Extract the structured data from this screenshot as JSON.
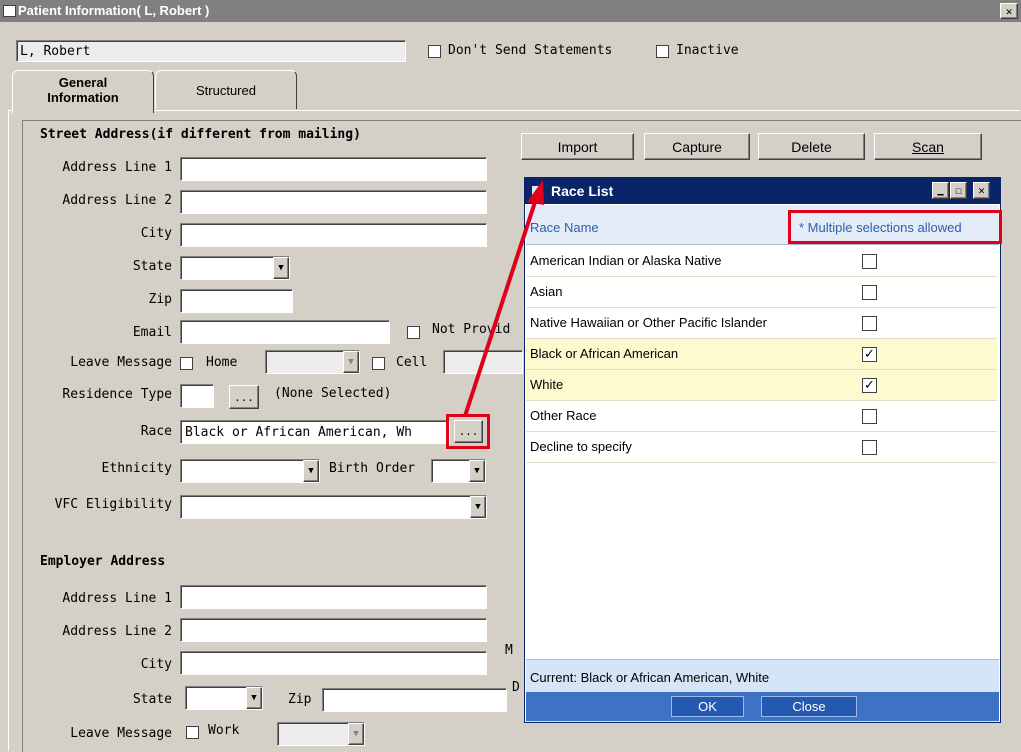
{
  "window": {
    "title": "Patient Information( L, Robert )",
    "close_glyph": "✕"
  },
  "patient": {
    "name": "L, Robert",
    "dont_send_label": "Don't Send Statements",
    "inactive_label": "Inactive"
  },
  "tabs": [
    {
      "label_line1": "General",
      "label_line2": "Information"
    },
    {
      "label": "Structured"
    }
  ],
  "street": {
    "section_title": "Street Address(if different from mailing)",
    "address1": "Address Line 1",
    "address2": "Address Line 2",
    "city": "City",
    "state": "State",
    "zip": "Zip",
    "email": "Email",
    "not_provided": "Not Provid",
    "leave_message": "Leave Message",
    "home": "Home",
    "cell": "Cell",
    "residence_type": "Residence Type",
    "residence_value": "(None Selected)",
    "race": "Race",
    "race_value": "Black or African American, Wh",
    "ethnicity": "Ethnicity",
    "birth_order": "Birth Order",
    "vfc": "VFC Eligibility"
  },
  "employer": {
    "section_title": "Employer Address",
    "address1": "Address Line 1",
    "address2": "Address Line 2",
    "city": "City",
    "state": "State",
    "zip": "Zip",
    "leave_message": "Leave Message",
    "work": "Work"
  },
  "buttons": {
    "import": "Import",
    "capture": "Capture",
    "delete": "Delete",
    "scan": "Scan",
    "ellipsis": "..."
  },
  "clipped": {
    "m": "M",
    "d": "D"
  },
  "race_dialog": {
    "title": "Race List",
    "column_header": "Race Name",
    "note": "* Multiple selections allowed",
    "items": [
      {
        "name": "American Indian or Alaska Native",
        "checked": false
      },
      {
        "name": "Asian",
        "checked": false
      },
      {
        "name": "Native Hawaiian or Other Pacific Islander",
        "checked": false
      },
      {
        "name": "Black or African American",
        "checked": true
      },
      {
        "name": "White",
        "checked": true
      },
      {
        "name": "Other Race",
        "checked": false
      },
      {
        "name": "Decline to specify",
        "checked": false
      }
    ],
    "current": "Current: Black or African American, White",
    "ok": "OK",
    "close": "Close"
  },
  "colors": {
    "highlight": "#e0001a",
    "selected_row": "#fdfacf",
    "dialog_title": "#0a246a",
    "note_text": "#2e5fa8"
  }
}
